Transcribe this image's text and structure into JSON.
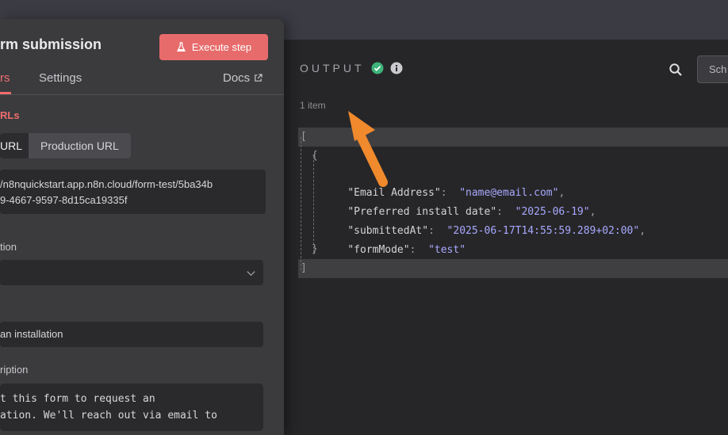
{
  "node": {
    "title": "rm submission",
    "execute_label": "Execute step"
  },
  "tabs": {
    "parameters_label": "rs",
    "settings_label": "Settings",
    "docs_label": "Docs"
  },
  "form": {
    "section_urls": "RLs",
    "url_test_label": "URL",
    "url_prod_label": "Production URL",
    "url_value_line1": "/n8nquickstart.app.n8n.cloud/form-test/5ba34b",
    "url_value_line2": "9-4667-9597-8d15ca19335f",
    "auth_label": "tion",
    "title_value": "an installation",
    "description_label": "ription",
    "description_line1": "t this form to request an",
    "description_line2": "ation. We'll reach out via email to"
  },
  "output": {
    "title": "OUTPUT",
    "items_count": "1 item",
    "schema_label": "Sch",
    "json": {
      "open_bracket": "[",
      "open_brace": "{",
      "rows": [
        {
          "key": "\"Email Address\"",
          "value": "\"name@email.com\""
        },
        {
          "key": "\"Preferred install date\"",
          "value": "\"2025-06-19\""
        },
        {
          "key": "\"submittedAt\"",
          "value": "\"2025-06-17T14:55:59.289+02:00\""
        },
        {
          "key": "\"formMode\"",
          "value": "\"test\""
        }
      ],
      "close_brace": "}",
      "close_bracket": "]"
    }
  },
  "colors": {
    "accent": "#ef6d6d",
    "execute_bg": "#e86b6b",
    "success": "#3fb37a",
    "annotation_arrow": "#f08a2c",
    "json_value": "#a8a8ff"
  },
  "icons": {
    "execute": "flask-icon",
    "docs": "external-link-icon",
    "status": "check-circle-icon",
    "info": "info-icon",
    "search": "search-icon",
    "select": "chevron-down-icon"
  }
}
